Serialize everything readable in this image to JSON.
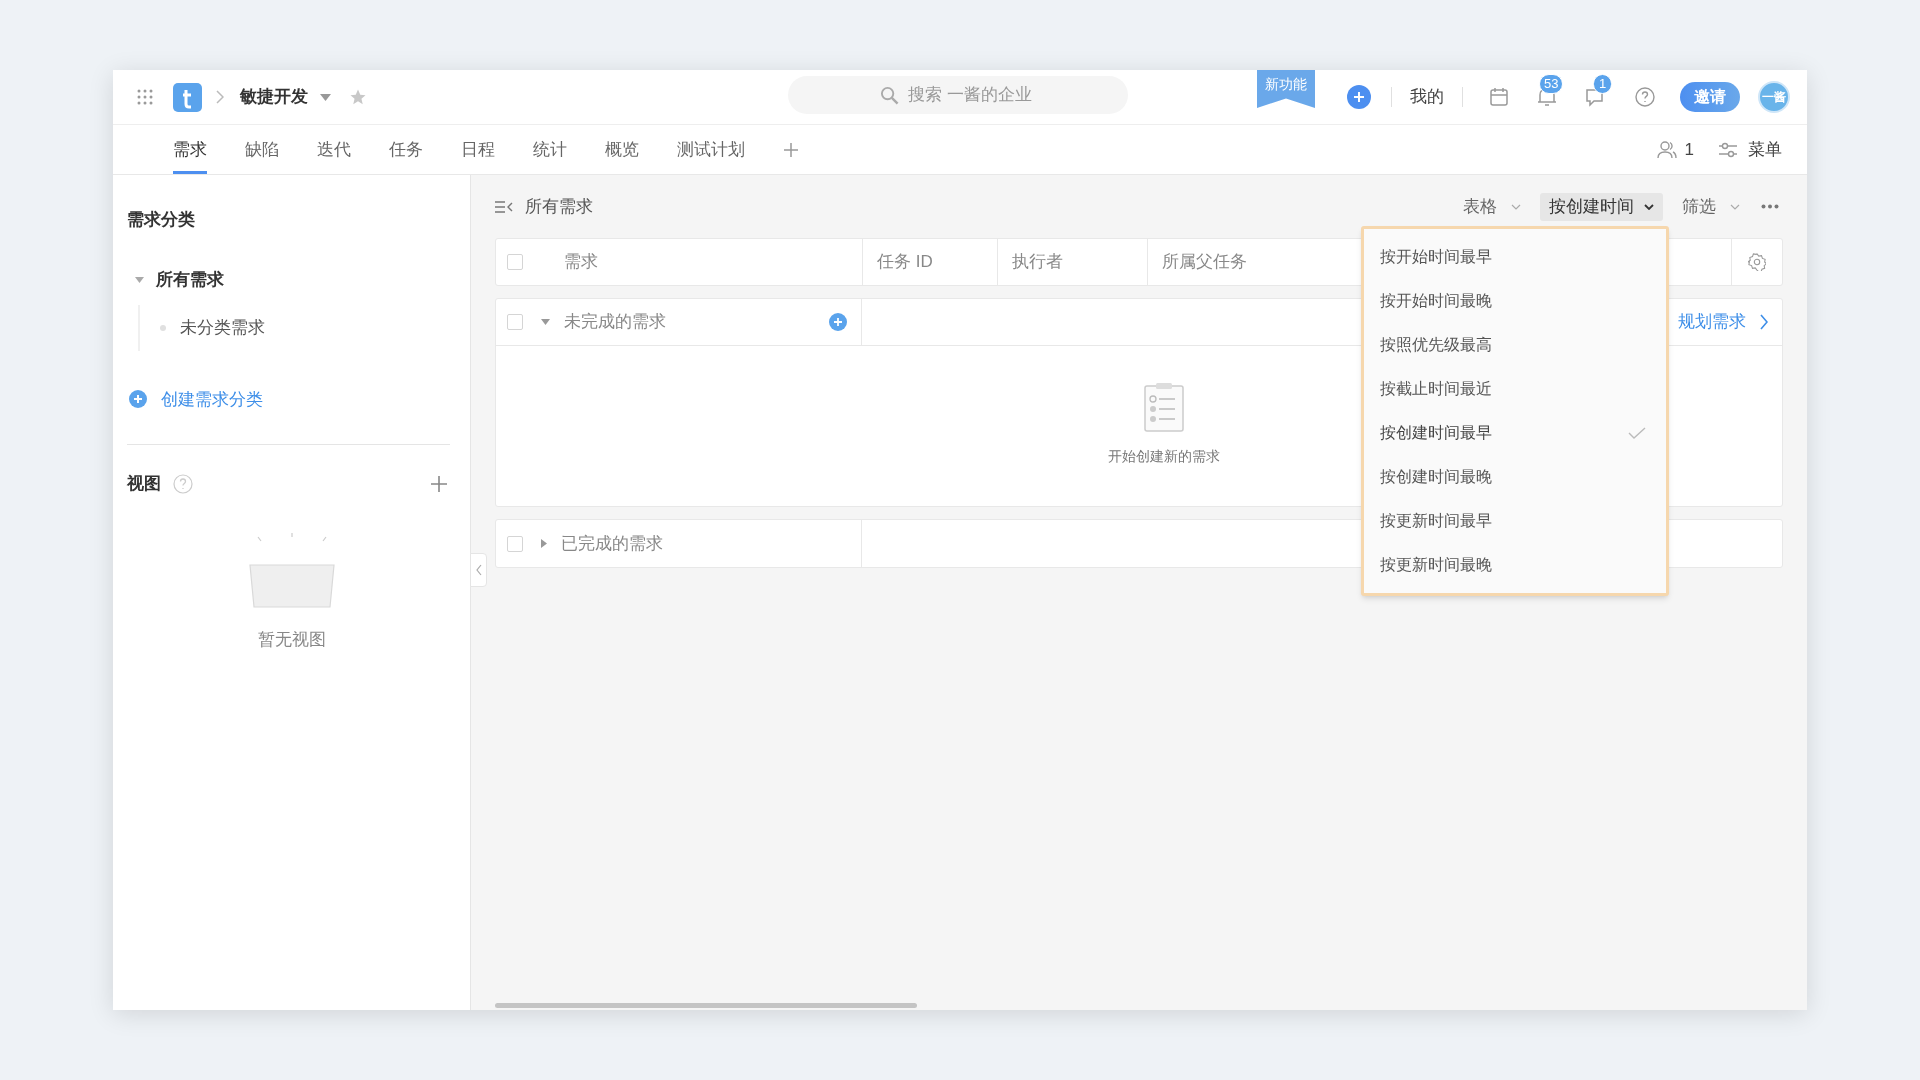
{
  "top_bar": {
    "project": "敏捷开发",
    "search": {
      "placeholder": "搜索 一酱的企业"
    },
    "new_feature": "新功能",
    "mine": "我的",
    "notifications_badge": "53",
    "messages_badge": "1",
    "invite": "邀请",
    "avatar": "一酱"
  },
  "tabs": [
    {
      "label": "需求",
      "selected": true
    },
    {
      "label": "缺陷",
      "selected": false
    },
    {
      "label": "迭代",
      "selected": false
    },
    {
      "label": "任务",
      "selected": false
    },
    {
      "label": "日程",
      "selected": false
    },
    {
      "label": "统计",
      "selected": false
    },
    {
      "label": "概览",
      "selected": false
    },
    {
      "label": "测试计划",
      "selected": false
    }
  ],
  "tab_bar_right": {
    "members": "1",
    "menu": "菜单"
  },
  "sidebar": {
    "title": "需求分类",
    "tree": [
      {
        "label": "所有需求",
        "expanded": true,
        "children": [
          {
            "label": "未分类需求"
          }
        ]
      }
    ],
    "create": "创建需求分类",
    "views": {
      "title": "视图",
      "empty": "暂无视图"
    }
  },
  "main": {
    "title": "所有需求",
    "toolbar": [
      {
        "label": "表格",
        "open": false
      },
      {
        "label": "按创建时间",
        "open": true
      },
      {
        "label": "筛选",
        "open": false
      }
    ],
    "select_all_checked": false,
    "columns": [
      "需求",
      "任务 ID",
      "执行者",
      "所属父任务"
    ],
    "groups": [
      {
        "label": "未完成的需求",
        "checked": false,
        "expanded": true,
        "empty_text": "开始创建新的需求",
        "plan_link": "规划需求"
      },
      {
        "label": "已完成的需求",
        "checked": false,
        "expanded": false
      }
    ]
  },
  "sort_menu": {
    "items": [
      {
        "label": "按开始时间最早",
        "selected": false
      },
      {
        "label": "按开始时间最晚",
        "selected": false
      },
      {
        "label": "按照优先级最高",
        "selected": false
      },
      {
        "label": "按截止时间最近",
        "selected": false
      },
      {
        "label": "按创建时间最早",
        "selected": true
      },
      {
        "label": "按创建时间最晚",
        "selected": false
      },
      {
        "label": "按更新时间最早",
        "selected": false
      },
      {
        "label": "按更新时间最晚",
        "selected": false
      }
    ]
  }
}
